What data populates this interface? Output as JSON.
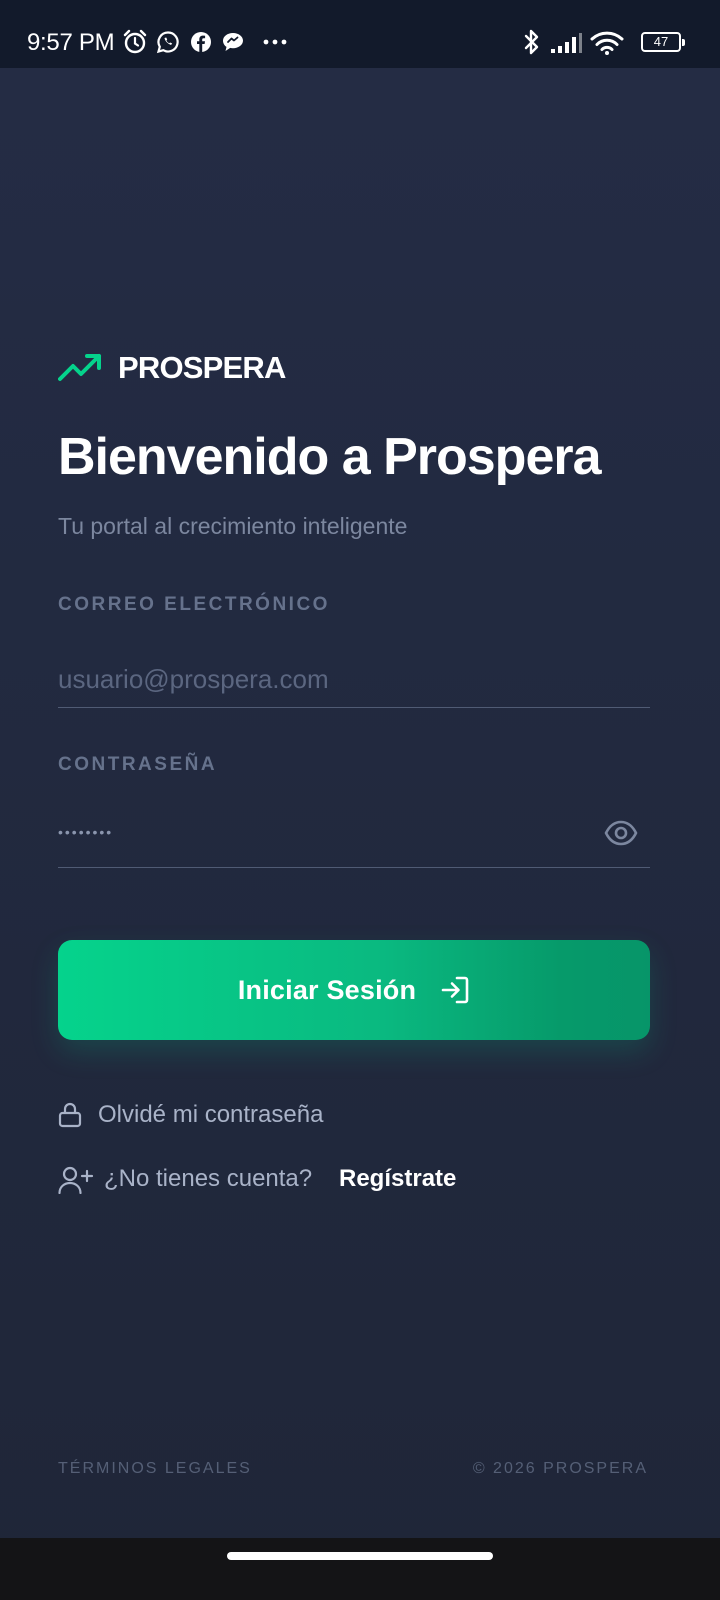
{
  "status_bar": {
    "time": "9:57 PM",
    "battery": "47",
    "icons": [
      "alarm-icon",
      "whatsapp-icon",
      "facebook-icon",
      "chat-icon",
      "more-dots-icon",
      "bluetooth-icon",
      "signal-icon",
      "wifi-icon",
      "battery-icon"
    ]
  },
  "brand": {
    "name": "PROSPERA",
    "logo_icon": "trending-up-icon",
    "accent_color": "#05d38c"
  },
  "title": "Bienvenido a Prospera",
  "subtitle": "Tu portal al crecimiento inteligente",
  "email": {
    "label": "CORREO ELECTRÓNICO",
    "placeholder": "usuario@prospera.com",
    "value": ""
  },
  "password": {
    "label": "CONTRASEÑA",
    "value": "••••••••",
    "toggle_icon": "eye-icon"
  },
  "login_button": {
    "label": "Iniciar Sesión",
    "icon": "login-icon"
  },
  "forgot": {
    "label": "Olvidé mi contraseña",
    "icon": "lock-icon"
  },
  "register": {
    "question": "¿No tienes cuenta?",
    "link": "Regístrate",
    "icon": "user-plus-icon"
  },
  "footer": {
    "terms": "TÉRMINOS LEGALES",
    "copyright": "© 2026 PROSPERA"
  },
  "colors": {
    "background": "#232a40",
    "status_bar": "#121a2b",
    "accent": "#05d38c",
    "muted_text": "#7c879f"
  }
}
